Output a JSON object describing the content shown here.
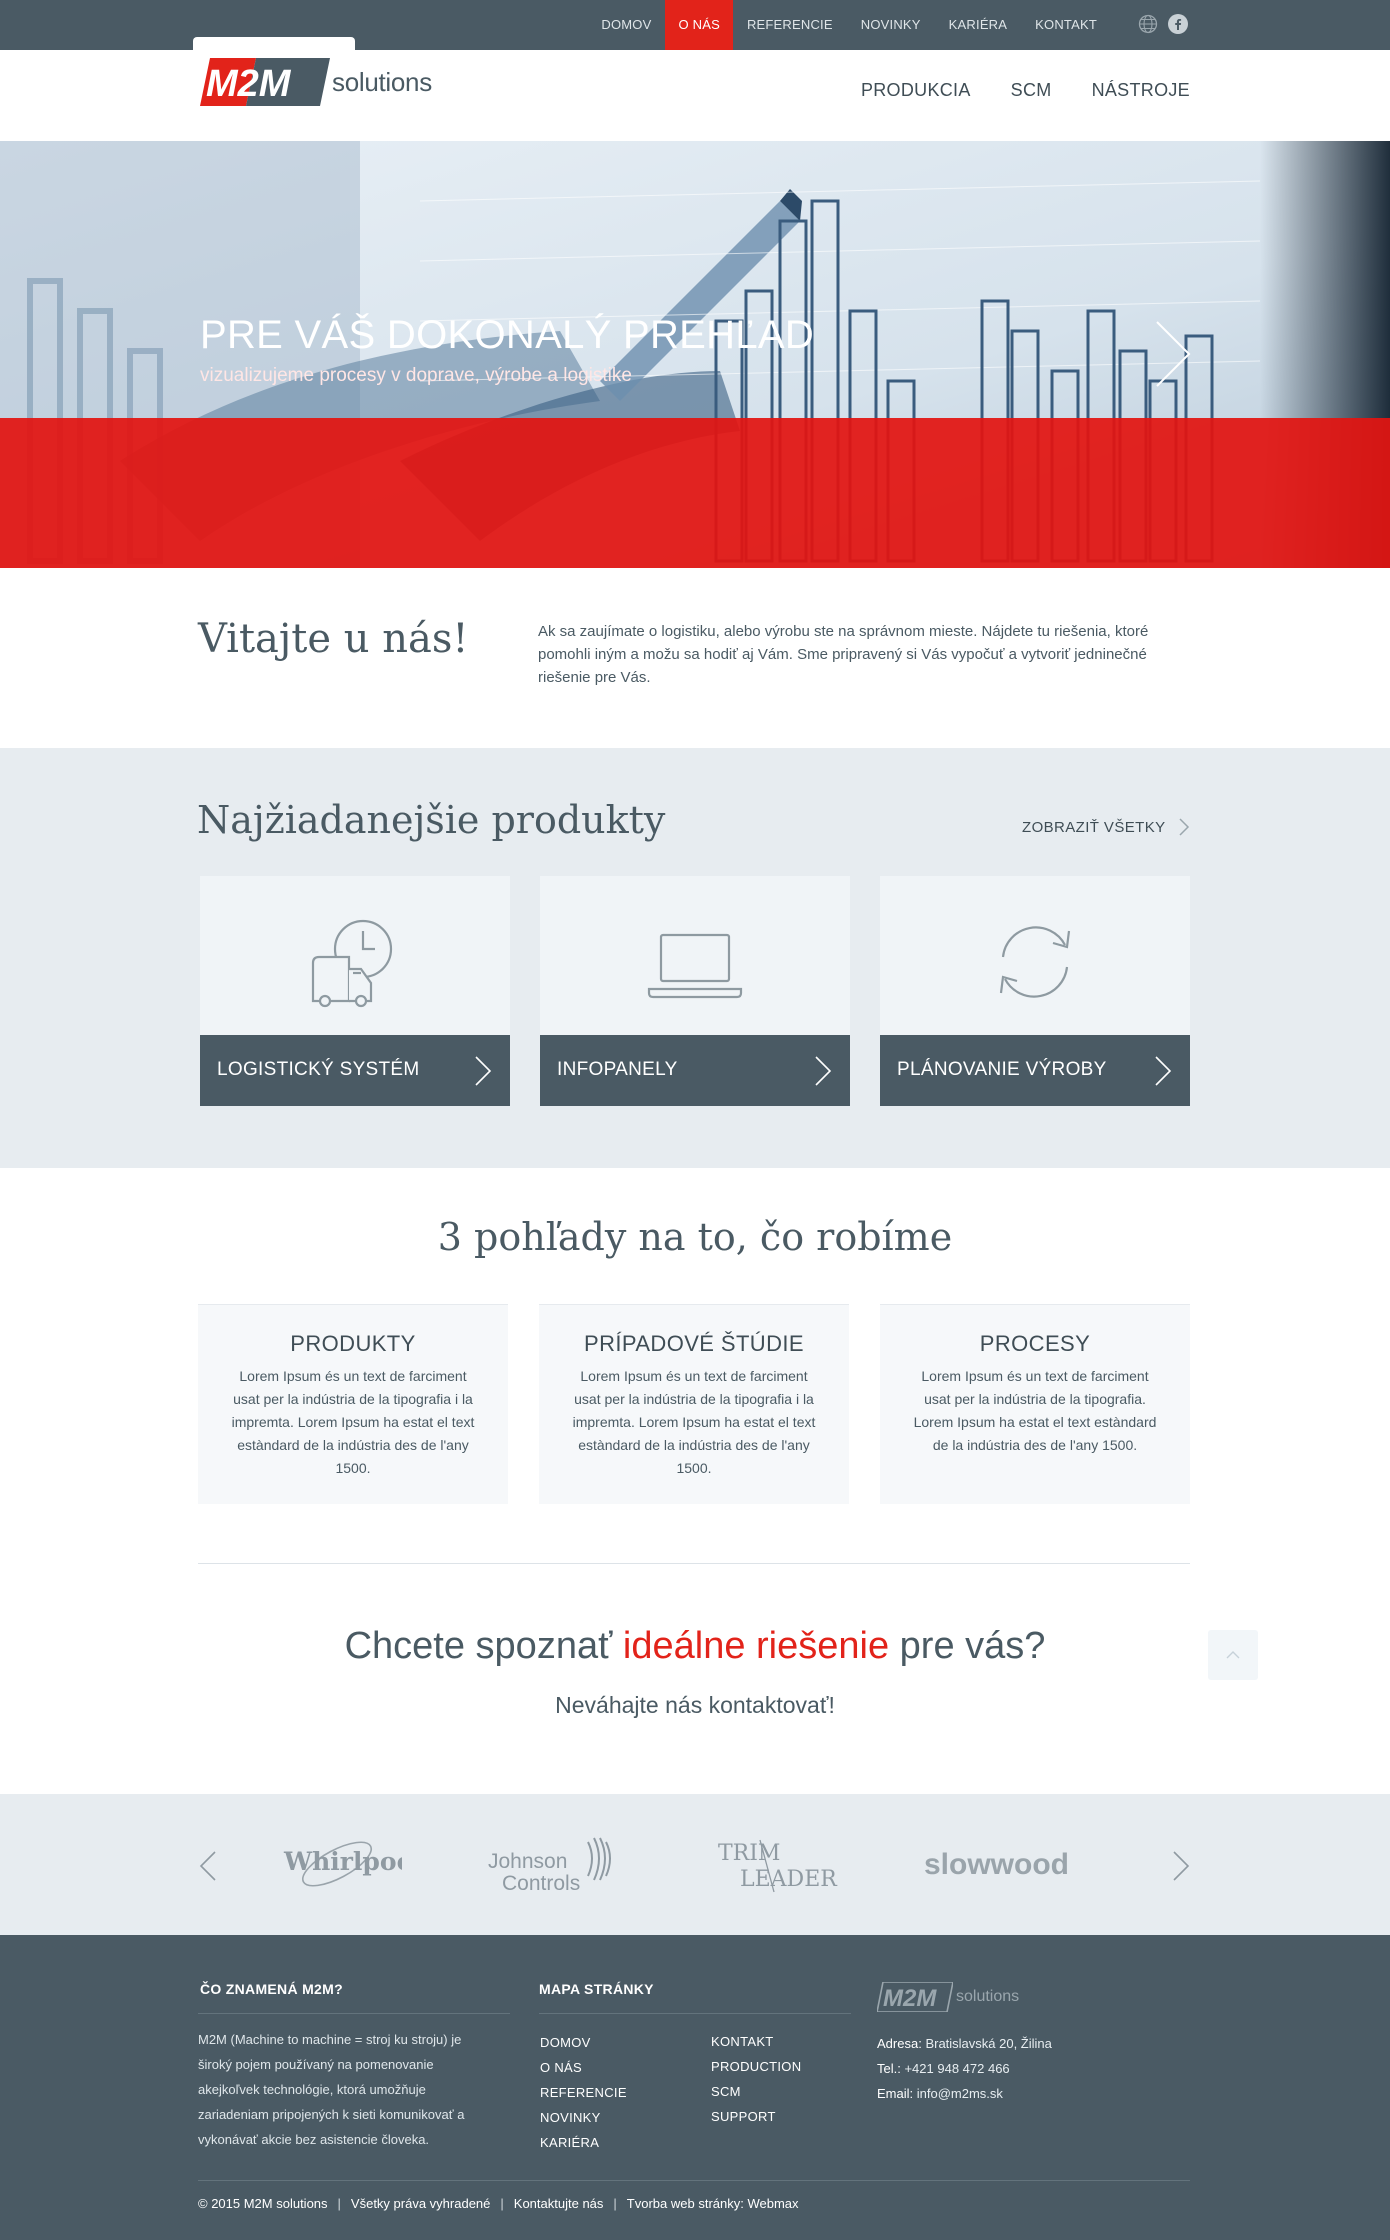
{
  "top_nav": [
    "DOMOV",
    "O NÁS",
    "REFERENCIE",
    "NOVINKY",
    "KARIÉRA",
    "KONTAKT"
  ],
  "top_nav_active": "O NÁS",
  "brand": {
    "logo_mark": "M2M",
    "logo_text": "solutions",
    "accent": "#e2231a",
    "slate": "#4a5a64"
  },
  "main_nav": [
    "PRODUKCIA",
    "SCM",
    "NÁSTROJE"
  ],
  "hero": {
    "title": "PRE VÁŠ DOKONALÝ PREHĽAD",
    "subtitle": "vizualizujeme procesy v doprave, výrobe a logistike"
  },
  "welcome": {
    "title": "Vitajte u nás!",
    "text": "Ak sa zaujímate o logistiku, alebo výrobu ste na správnom mieste. Nájdete tu riešenia, ktoré pomohli iným a možu sa hodiť aj Vám. Sme pripravený si Vás vypočuť a vytvoriť jedninečné riešenie pre Vás."
  },
  "products": {
    "title": "Najžiadanejšie produkty",
    "show_all": "ZOBRAZIŤ VŠETKY",
    "cards": [
      {
        "label": "LOGISTICKÝ SYSTÉM",
        "icon": "truck-clock-icon"
      },
      {
        "label": "INFOPANELY",
        "icon": "laptop-icon"
      },
      {
        "label": "PLÁNOVANIE VÝROBY",
        "icon": "refresh-icon"
      }
    ]
  },
  "views": {
    "title": "3 pohľady na to, čo robíme",
    "items": [
      {
        "title": "PRODUKTY",
        "text": "Lorem Ipsum és un text de farciment usat per la indústria de la tipografia i la impremta. Lorem Ipsum ha estat el text estàndard de la indústria des de l'any 1500."
      },
      {
        "title": "PRÍPADOVÉ ŠTÚDIE",
        "text": "Lorem Ipsum és un text de farciment usat per la indústria de la tipografia i la impremta. Lorem Ipsum ha estat el text estàndard de la indústria des de l'any 1500."
      },
      {
        "title": "PROCESY",
        "text": "Lorem Ipsum és un text de farciment usat per la indústria de la tipografia. Lorem Ipsum ha estat el text estàndard de la indústria des de l'any 1500."
      }
    ]
  },
  "cta": {
    "title_before": "Chcete spoznať ",
    "title_accent": "ideálne riešenie",
    "title_after": " pre vás?",
    "subtitle": "Neváhajte nás kontaktovať!"
  },
  "partners": {
    "logos": [
      "Whirlpool",
      "Johnson",
      "Controls",
      "TRIM",
      "LEADER",
      "slowwood"
    ]
  },
  "footer": {
    "about_head": "ČO ZNAMENÁ M2M?",
    "about_text": "M2M (Machine to machine = stroj ku stroju) je široký pojem používaný na pomenovanie akejkoľvek technológie, ktorá umožňuje zariadeniam pripojených k sieti komunikovať a vykonávať akcie bez asistencie človeka.",
    "map_head": "MAPA STRÁNKY",
    "map_col1": [
      "DOMOV",
      "O NÁS",
      "REFERENCIE",
      "NOVINKY",
      "KARIÉRA"
    ],
    "map_col2": [
      "KONTAKT",
      "PRODUCTION",
      "SCM",
      "SUPPORT"
    ],
    "logo_mark": "M2M",
    "logo_text": "solutions",
    "address_label": "Adresa:",
    "address": "Bratislavská 20, Žilina",
    "phone_label": "Tel.:",
    "phone": "+421 948 472 466",
    "email_label": "Email:",
    "email": "info@m2ms.sk",
    "copyright": "© 2015 M2M solutions",
    "rights": "Všetky práva vyhradené",
    "contact": "Kontaktujte nás",
    "made_by": "Tvorba web stránky: Webmax"
  }
}
